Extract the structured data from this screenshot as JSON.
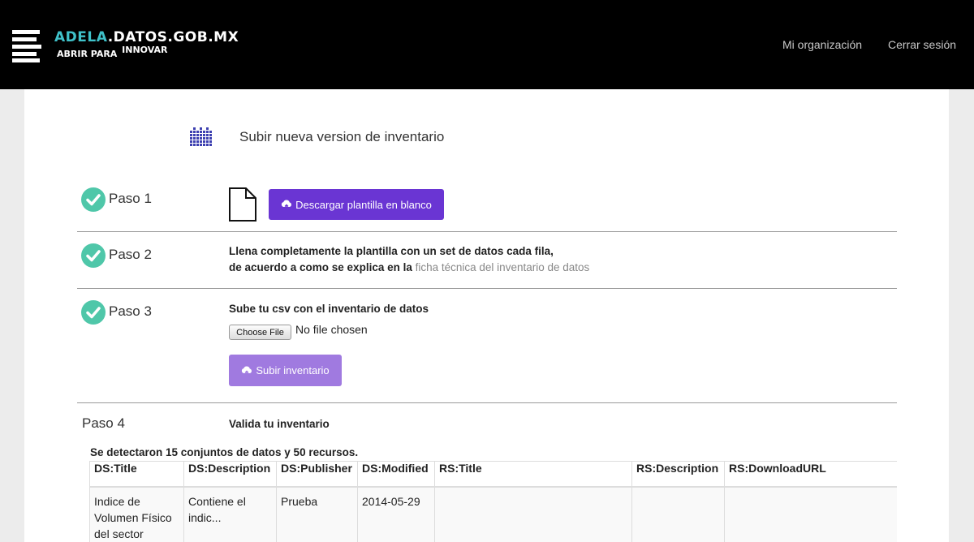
{
  "header": {
    "logo_accent": "ADELA",
    "logo_rest": ".DATOS.GOB.MX",
    "tagline_main": "ABRIR PARA",
    "tagline_raised": "INNOVAR",
    "nav": [
      "Mi organización",
      "Cerrar sesión"
    ]
  },
  "page": {
    "title": "Subir nueva version de inventario"
  },
  "steps": {
    "step1": {
      "label": "Paso 1",
      "button": "Descargar plantilla en blanco"
    },
    "step2": {
      "label": "Paso 2",
      "line1": "Llena completamente la plantilla con un set de datos cada fila,",
      "line2": "de acuerdo a como se explica en la",
      "link": "ficha técnica del inventario de datos"
    },
    "step3": {
      "label": "Paso 3",
      "instruction": "Sube tu csv con el inventario de datos",
      "file_button": "Choose File",
      "file_status": "No file chosen",
      "upload_button": "Subir inventario"
    },
    "step4": {
      "label": "Paso 4",
      "instruction": "Valida tu inventario"
    }
  },
  "summary": "Se detectaron 15 conjuntos de datos y 50 recursos.",
  "table": {
    "columns": [
      "DS:Title",
      "DS:Description",
      "DS:Publisher",
      "DS:Modified",
      "RS:Title",
      "RS:Description",
      "RS:DownloadURL"
    ],
    "rows": [
      [
        "Indice de Volumen Físico del sector",
        "Contiene el indic...",
        "Prueba",
        "2014-05-29",
        "",
        "",
        ""
      ]
    ]
  },
  "colors": {
    "header_bg": "#000000",
    "accent_teal": "#3fc1c9",
    "primary_purple": "#6a35d3",
    "disabled_purple": "#a07ae0",
    "check_green": "#4fc7a9"
  }
}
